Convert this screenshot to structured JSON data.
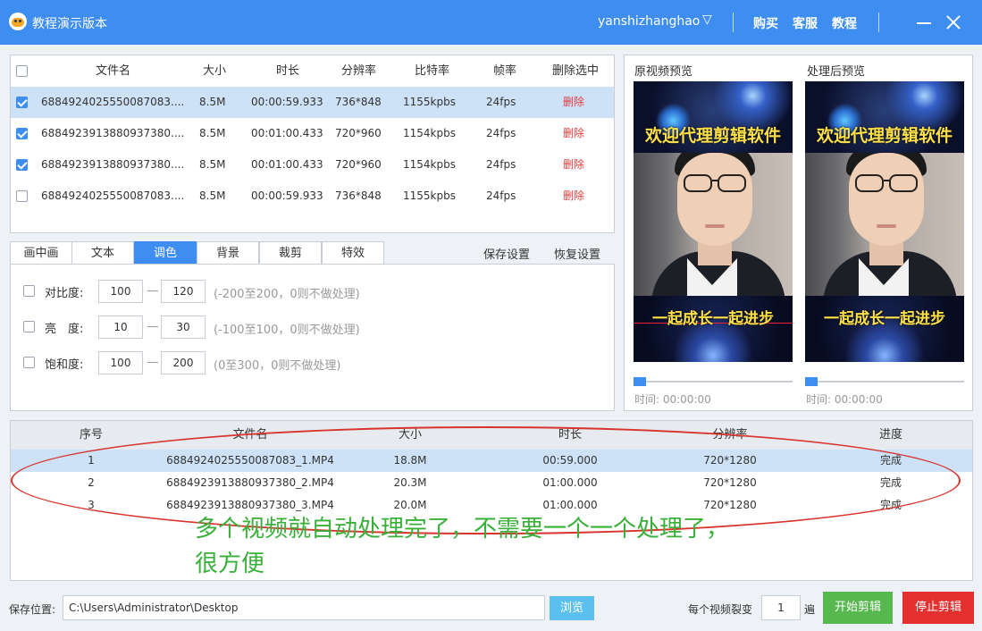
{
  "titlebar": {
    "app_title": "教程演示版本",
    "username": "yanshizhanghao",
    "caret": "▽",
    "links": [
      "购买",
      "客服",
      "教程"
    ]
  },
  "file_table": {
    "headers": [
      "文件名",
      "大小",
      "时长",
      "分辨率",
      "比特率",
      "帧率",
      "删除选中"
    ],
    "rows": [
      {
        "checked": true,
        "name": "6884924025550087083....",
        "size": "8.5M",
        "duration": "00:00:59.933",
        "res": "736*848",
        "bitrate": "1155kpbs",
        "fps": "24fps",
        "action": "删除"
      },
      {
        "checked": true,
        "name": "6884923913880937380....",
        "size": "8.5M",
        "duration": "00:01:00.433",
        "res": "720*960",
        "bitrate": "1154kpbs",
        "fps": "24fps",
        "action": "删除"
      },
      {
        "checked": true,
        "name": "6884923913880937380....",
        "size": "8.5M",
        "duration": "00:01:00.433",
        "res": "720*960",
        "bitrate": "1154kpbs",
        "fps": "24fps",
        "action": "删除"
      },
      {
        "checked": false,
        "name": "6884924025550087083....",
        "size": "8.5M",
        "duration": "00:00:59.933",
        "res": "736*848",
        "bitrate": "1155kpbs",
        "fps": "24fps",
        "action": "删除"
      }
    ]
  },
  "tabs": {
    "items": [
      "画中画",
      "文本",
      "调色",
      "背景",
      "裁剪",
      "特效"
    ],
    "active": "调色",
    "save": "保存设置",
    "restore": "恢复设置"
  },
  "color_settings": [
    {
      "label": "对比度:",
      "min": "100",
      "max": "120",
      "hint": "(-200至200，0则不做处理)"
    },
    {
      "label": "亮　度:",
      "min": "10",
      "max": "30",
      "hint": "(-100至100，0则不做处理)"
    },
    {
      "label": "饱和度:",
      "min": "100",
      "max": "200",
      "hint": "(0至300，0则不做处理)"
    }
  ],
  "preview": {
    "original_title": "原视频预览",
    "processed_title": "处理后预览",
    "caption_top": "欢迎代理剪辑软件",
    "caption_bottom": "一起成长一起进步",
    "time_original": "时间:  00:00:00",
    "time_processed": "时间:  00:00:00",
    "progress": 0
  },
  "output_table": {
    "headers": [
      "序号",
      "文件名",
      "大小",
      "时长",
      "分辨率",
      "进度"
    ],
    "rows": [
      {
        "index": "1",
        "name": "6884924025550087083_1.MP4",
        "size": "18.8M",
        "duration": "00:59.000",
        "res": "720*1280",
        "status": "完成"
      },
      {
        "index": "2",
        "name": "6884923913880937380_2.MP4",
        "size": "20.3M",
        "duration": "01:00.000",
        "res": "720*1280",
        "status": "完成"
      },
      {
        "index": "3",
        "name": "6884923913880937380_3.MP4",
        "size": "20.0M",
        "duration": "01:00.000",
        "res": "720*1280",
        "status": "完成"
      }
    ]
  },
  "annotation": {
    "line1": "多个视频就自动处理完了，不需要一个一个处理了，",
    "line2": "很方便",
    "text_color": "#39b03a",
    "circle_color": "#d8332c"
  },
  "bottom": {
    "save_label": "保存位置:",
    "path": "C:\\Users\\Administrator\\Desktop",
    "browse": "浏览",
    "split_label": "每个视频裂变",
    "split_value": "1",
    "split_unit": "遍",
    "start": "开始剪辑",
    "stop": "停止剪辑"
  },
  "colors": {
    "accent": "#3d8ef0",
    "start_button": "#56b84f",
    "stop_button": "#e53030",
    "browse_button": "#5bc0f0",
    "delete_text": "#e83a3a"
  },
  "icons": [
    "app-logo-icon",
    "dropdown-caret-icon",
    "minimize-icon",
    "close-icon",
    "checkbox-icon"
  ]
}
